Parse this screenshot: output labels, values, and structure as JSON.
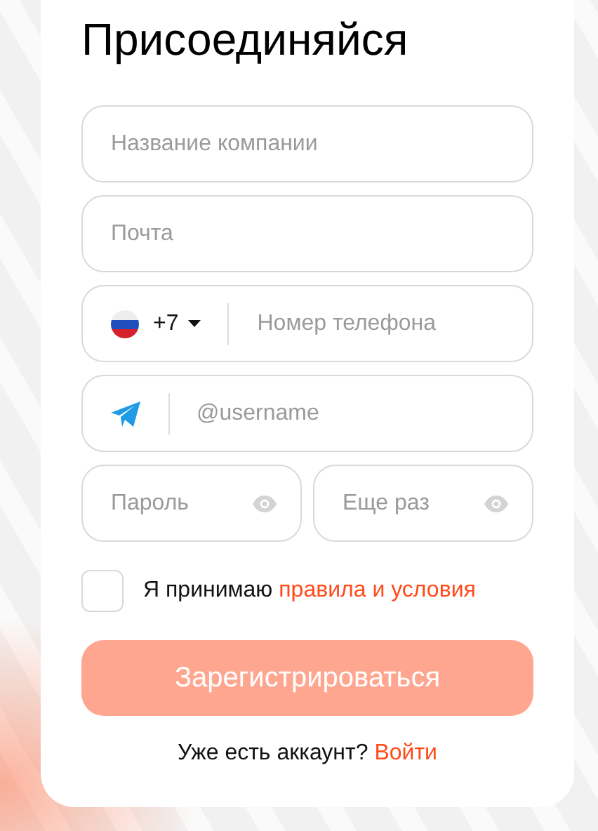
{
  "title": "Присоединяйся",
  "fields": [
    {
      "kind": "text",
      "placeholder": "Название компании"
    },
    {
      "kind": "text",
      "placeholder": "Почта"
    },
    {
      "kind": "phone",
      "country_code": "+7",
      "placeholder": "Номер телефона"
    },
    {
      "kind": "telegram",
      "placeholder": "@username"
    },
    {
      "kind": "password",
      "placeholder": "Пароль"
    },
    {
      "kind": "password",
      "placeholder": "Еще раз"
    }
  ],
  "terms": {
    "checked": false,
    "text": "Я принимаю",
    "link": "правила и условия"
  },
  "submit": {
    "label": "Зарегистрироваться",
    "disabled": true
  },
  "footer": {
    "text": "Уже есть аккаунт?",
    "link": "Войти"
  }
}
